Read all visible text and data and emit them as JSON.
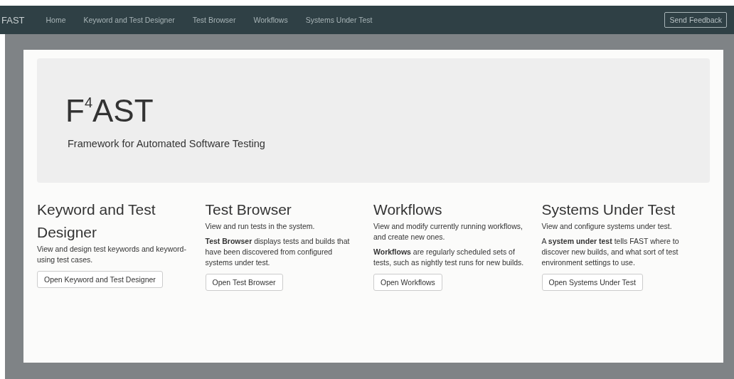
{
  "navbar": {
    "brand": "FAST",
    "links": [
      {
        "label": "Home"
      },
      {
        "label": "Keyword and Test Designer"
      },
      {
        "label": "Test Browser"
      },
      {
        "label": "Workflows"
      },
      {
        "label": "Systems Under Test"
      }
    ],
    "feedback_button": "Send Feedback"
  },
  "hero": {
    "title": "F$^{4}$AST",
    "subtitle": "Framework for Automated Software Testing"
  },
  "sections": [
    {
      "heading": "Keyword and Test Designer",
      "lead": "View and design test keywords and keyword-using test cases.",
      "button": "Open Keyword and Test Designer"
    },
    {
      "heading": "Test Browser",
      "lead": "View and run tests in the system.",
      "body": "**Test Browser** displays tests and builds that have been discovered from configured systems under test.",
      "button": "Open Test Browser"
    },
    {
      "heading": "Workflows",
      "lead": "View and modify currently running workflows, and create new ones.",
      "body": "**Workflows** are regularly scheduled sets of tests, such as nightly test runs for new builds.",
      "button": "Open Workflows"
    },
    {
      "heading": "Systems Under Test",
      "lead": "View and configure systems under test.",
      "body": "A **system under test** tells FAST where to discover new builds, and what sort of test environment settings to use.",
      "button": "Open Systems Under Test"
    }
  ]
}
